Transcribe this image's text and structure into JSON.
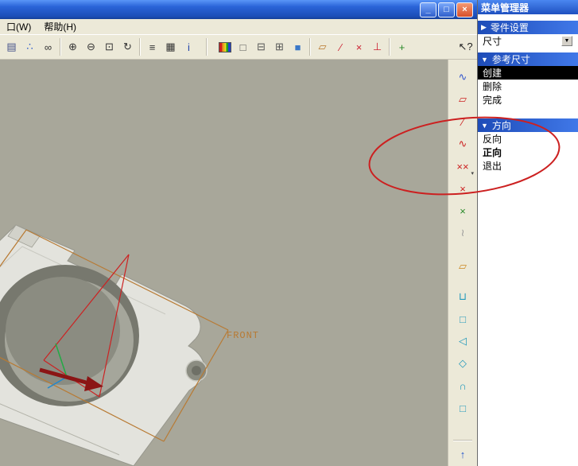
{
  "window": {
    "controls": {
      "minimize": "_",
      "restore": "□",
      "close": "×"
    }
  },
  "menubar": {
    "items": [
      {
        "label": "口(W)"
      },
      {
        "label": "帮助(H)"
      }
    ]
  },
  "toolbar": {
    "icons": [
      {
        "name": "print-icon",
        "glyph": "▤",
        "color": "#44518a"
      },
      {
        "name": "model-tree-icon",
        "glyph": "∴",
        "color": "#2255cc"
      },
      {
        "name": "find-icon",
        "glyph": "∞",
        "color": "#333333"
      },
      {
        "name": "zoom-in-icon",
        "glyph": "⊕",
        "color": "#333333"
      },
      {
        "name": "zoom-out-icon",
        "glyph": "⊖",
        "color": "#333333"
      },
      {
        "name": "refit-icon",
        "glyph": "⊡",
        "color": "#333333"
      },
      {
        "name": "reorient-icon",
        "glyph": "↻",
        "color": "#333333"
      },
      {
        "name": "layer-icon",
        "glyph": "≡",
        "color": "#333333"
      },
      {
        "name": "view-manager-icon",
        "glyph": "▦",
        "color": "#333333"
      },
      {
        "name": "info-icon",
        "glyph": "i",
        "color": "#2244aa"
      },
      {
        "name": "color-palette-icon",
        "glyph": "",
        "color": "#cc2020"
      },
      {
        "name": "wireframe-display-icon",
        "glyph": "□",
        "color": "#555555"
      },
      {
        "name": "hidden-line-display-icon",
        "glyph": "⊟",
        "color": "#555555"
      },
      {
        "name": "no-hidden-display-icon",
        "glyph": "⊞",
        "color": "#555555"
      },
      {
        "name": "shaded-display-icon",
        "glyph": "■",
        "color": "#3a78c8"
      },
      {
        "name": "datum-plane-toggle-icon",
        "glyph": "▱",
        "color": "#b8762a"
      },
      {
        "name": "datum-axis-toggle-icon",
        "glyph": "∕",
        "color": "#cc2233"
      },
      {
        "name": "datum-point-toggle-icon",
        "glyph": "×",
        "color": "#cc2233"
      },
      {
        "name": "csys-toggle-icon",
        "glyph": "⊥",
        "color": "#cc2233"
      },
      {
        "name": "spin-center-toggle-icon",
        "glyph": "+",
        "color": "#2a8a2a"
      },
      {
        "name": "context-help-icon",
        "glyph": "↖?",
        "color": "#222222"
      }
    ]
  },
  "right_toolbar": {
    "icons": [
      {
        "name": "datum-curve-icon",
        "glyph": "∿",
        "color": "#3355cc"
      },
      {
        "name": "sketch-rect-icon",
        "glyph": "▱",
        "color": "#cc2222"
      },
      {
        "name": "sketch-line-icon",
        "glyph": "∕",
        "color": "#cc2222"
      },
      {
        "name": "sketch-spline-icon",
        "glyph": "∿",
        "color": "#cc2222"
      },
      {
        "name": "sketch-point-icon",
        "glyph": "××",
        "color": "#cc2222",
        "dropdown": "▾"
      },
      {
        "name": "datum-csys-icon",
        "glyph": "×",
        "color": "#cc2222"
      },
      {
        "name": "datum-point-icon",
        "glyph": "×",
        "color": "#2a8a2a"
      },
      {
        "name": "datum-axis-icon",
        "glyph": "≀",
        "color": "#999999"
      },
      {
        "name": "surface-icon",
        "glyph": "▱",
        "color": "#cc8822"
      },
      {
        "name": "extrude-icon",
        "glyph": "⊔",
        "color": "#2299bb"
      },
      {
        "name": "revolve-icon",
        "glyph": "□",
        "color": "#2299bb"
      },
      {
        "name": "sweep-icon",
        "glyph": "◁",
        "color": "#2299bb"
      },
      {
        "name": "blend-icon",
        "glyph": "◇",
        "color": "#2299bb"
      },
      {
        "name": "round-icon",
        "glyph": "∩",
        "color": "#2299bb"
      },
      {
        "name": "rib-icon",
        "glyph": "□",
        "color": "#2299bb"
      },
      {
        "name": "scroll-up-icon",
        "glyph": "↑",
        "color": "#2255cc"
      }
    ]
  },
  "canvas": {
    "front_label": "FRONT",
    "background": "#a8a79a",
    "front_label_color": "#b87a33"
  },
  "menu_manager": {
    "title": "菜单管理器",
    "part_setup": {
      "arrow": "▶",
      "label": "零件设置"
    },
    "dimension_item": {
      "label": "尺寸",
      "dropdown": "▼"
    },
    "ref_dim": {
      "arrow": "▼",
      "label": "参考尺寸"
    },
    "ref_dim_items": [
      {
        "label": "创建",
        "selected": true
      },
      {
        "label": "删除",
        "selected": false
      },
      {
        "label": "完成",
        "selected": false
      }
    ],
    "direction": {
      "arrow": "▼",
      "label": "方向"
    },
    "direction_items": [
      {
        "label": "反向",
        "bold": false
      },
      {
        "label": "正向",
        "bold": true
      },
      {
        "label": "退出",
        "bold": false
      }
    ]
  },
  "annotation": {
    "shape": "ellipse",
    "color": "#cc2020"
  },
  "colors": {
    "titlebar_blue": "#2a64d8",
    "menu_header_blue": "#2a5cd0",
    "selected_item_bg": "#000000",
    "canvas_bg": "#a8a79a"
  }
}
